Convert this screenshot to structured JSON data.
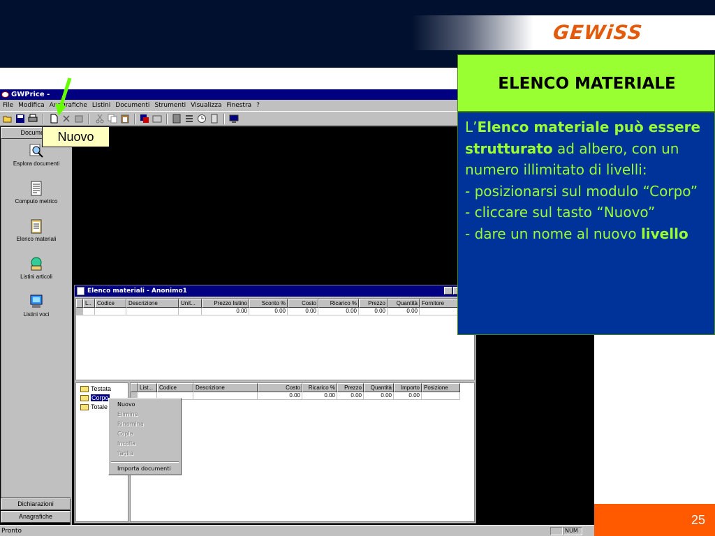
{
  "brand": {
    "logo_text": "GEWiSS",
    "accent": "#e25a0b"
  },
  "app": {
    "title": "GWPrice -",
    "menu": [
      "File",
      "Modifica",
      "Anagrafiche",
      "Listini",
      "Documenti",
      "Strumenti",
      "Visualizza",
      "Finestra",
      "?"
    ],
    "sidebar": {
      "top_button": "Documenti",
      "items": [
        "Esplora documenti",
        "Computo metrico",
        "Elenco materiali",
        "Listini articoli",
        "Listini voci"
      ],
      "bottom_buttons": [
        "Dichiarazioni",
        "Anagrafiche"
      ]
    },
    "status": {
      "text": "Pronto",
      "num": "NUM"
    }
  },
  "child": {
    "title": "Elenco materiali  -  Anonimo1",
    "top_grid": {
      "headers": [
        "L..",
        "Codice",
        "Descrizione",
        "Unit...",
        "Prezzo listino",
        "Sconto %",
        "Costo",
        "Ricarico %",
        "Prezzo",
        "Quantità",
        "Fornitore"
      ],
      "row": [
        "",
        "",
        "",
        "",
        "0.00",
        "0.00",
        "0.00",
        "0.00",
        "0.00",
        "0.00",
        ""
      ]
    },
    "tree": [
      "Testata",
      "Corpo",
      "Totale"
    ],
    "bottom_grid": {
      "headers": [
        "List...",
        "Codice",
        "Descrizione",
        "Costo",
        "Ricarico %",
        "Prezzo",
        "Quantità",
        "Importo",
        "Posizione"
      ],
      "row": [
        "",
        "",
        "",
        "0.00",
        "0.00",
        "0.00",
        "0.00",
        "0.00",
        ""
      ]
    },
    "context_menu": {
      "items": [
        {
          "label": "Nuovo",
          "enabled": true
        },
        {
          "label": "Elimina",
          "enabled": false
        },
        {
          "label": "Rinomina",
          "enabled": false
        },
        {
          "label": "Copia",
          "enabled": false
        },
        {
          "label": "Incolla",
          "enabled": false
        },
        {
          "label": "Taglia",
          "enabled": false
        }
      ],
      "last": "Importa documenti"
    }
  },
  "callout": {
    "label": "Nuovo"
  },
  "info": {
    "title": "ELENCO MATERIALE",
    "p1": "L’",
    "p1_bold": "Elenco materiale può essere strutturato",
    "p1_rest": " ad albero, con un numero illimitato di livelli:",
    "b1": "- posizionarsi sul modulo “Corpo”",
    "b2": "- cliccare sul tasto “Nuovo”",
    "b3": "- dare un nome al nuovo",
    "b3_bold": "livello"
  },
  "page_number": "25",
  "colors": {
    "header_bg": "#02102f",
    "panel_green": "#99ff33",
    "panel_blue": "#003399",
    "page_orange": "#ff5a00"
  }
}
